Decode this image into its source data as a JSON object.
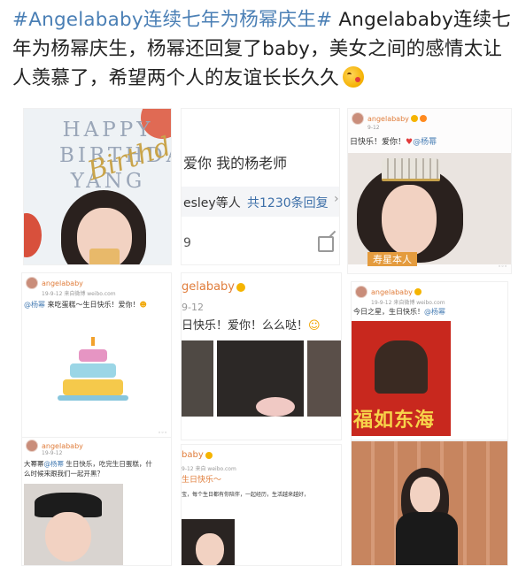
{
  "post": {
    "hashtag": "#Angelababy连续七年为杨幂庆生#",
    "body": " Angelababy连续七年为杨幂庆生，杨幂还回复了baby，美女之间的感情太让人羡慕了，希望两个人的友谊长长久久",
    "emoji_icon": "face-with-hearts-emoji"
  },
  "card1": {
    "title": "HAPPY BIRTHDAY YANG",
    "script_text": "Birthday"
  },
  "card2": {
    "caption": "爱你 我的杨老师",
    "reply_prefix": "esley等人",
    "reply_link": "共1230条回复",
    "reply_arrow": "›",
    "comment_count": "9",
    "edit_icon": "edit-icon"
  },
  "card3": {
    "username": "angelababy",
    "time": "9-12",
    "caption_prefix": "日快乐！爱你！",
    "mention": "@杨幂",
    "banner_text": "寿星本人"
  },
  "card4": {
    "username": "angelababy",
    "time": "19-9-12 来自微博 weibo.com",
    "caption_mention": "@杨幂",
    "caption": " 来吃蛋糕～生日快乐！爱你！"
  },
  "card5": {
    "username": "gelababy",
    "time": "9-12",
    "caption": "日快乐！爱你！么么哒！"
  },
  "card6": {
    "username": "angelababy",
    "time": "19-9-12 来自微博 weibo.com",
    "caption": "今日之星，生日快乐！",
    "mention": "@杨幂",
    "poster_text": "福如东海"
  },
  "card7": {
    "username": "angelababy",
    "time": "19-9-12",
    "caption_line1_prefix": "大幂幂",
    "mention": "@杨幂",
    "caption_line1_suffix": " 生日快乐，吃完生日蛋糕，什",
    "caption_line2": "么时候来跟我们一起开黑？"
  },
  "card8": {
    "username": "baby",
    "time": "9-12 来自 weibo.com",
    "caption_line1": "生日快乐～",
    "caption_line2": "宝，每个生日都有你陪伴，一起经历，生活越来越好，"
  },
  "colors": {
    "hashtag": "#4a7fb5",
    "username": "#e07d3b",
    "poster_red": "#c8281e",
    "poster_gold": "#f7d34a"
  }
}
